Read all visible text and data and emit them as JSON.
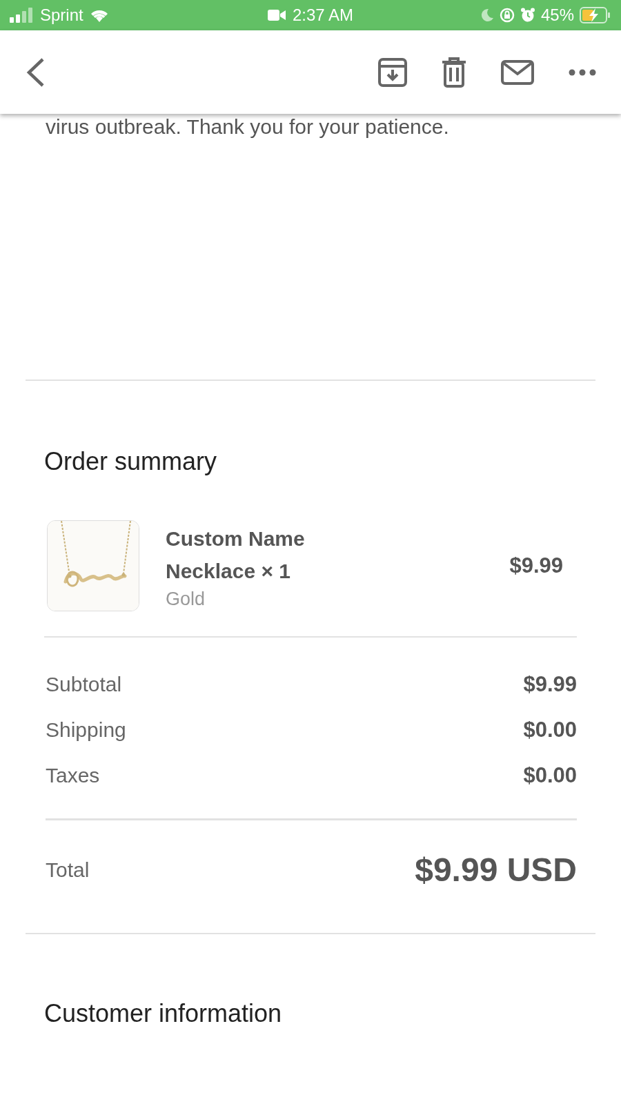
{
  "status_bar": {
    "carrier": "Sprint",
    "time": "2:37 AM",
    "battery": "45%"
  },
  "message_fragment": "virus outbreak. Thank you for your patience.",
  "order_summary": {
    "title": "Order summary",
    "items": [
      {
        "kind": "picture",
        "name": "Custom Name Necklace × 1",
        "variant": "Gold",
        "price": "$9.99"
      }
    ],
    "lines": [
      {
        "label": "Subtotal",
        "value": "$9.99"
      },
      {
        "label": "Shipping",
        "value": "$0.00"
      },
      {
        "label": "Taxes",
        "value": "$0.00"
      }
    ],
    "total": {
      "label": "Total",
      "value": "$9.99 USD"
    }
  },
  "customer_information": {
    "title": "Customer information"
  }
}
